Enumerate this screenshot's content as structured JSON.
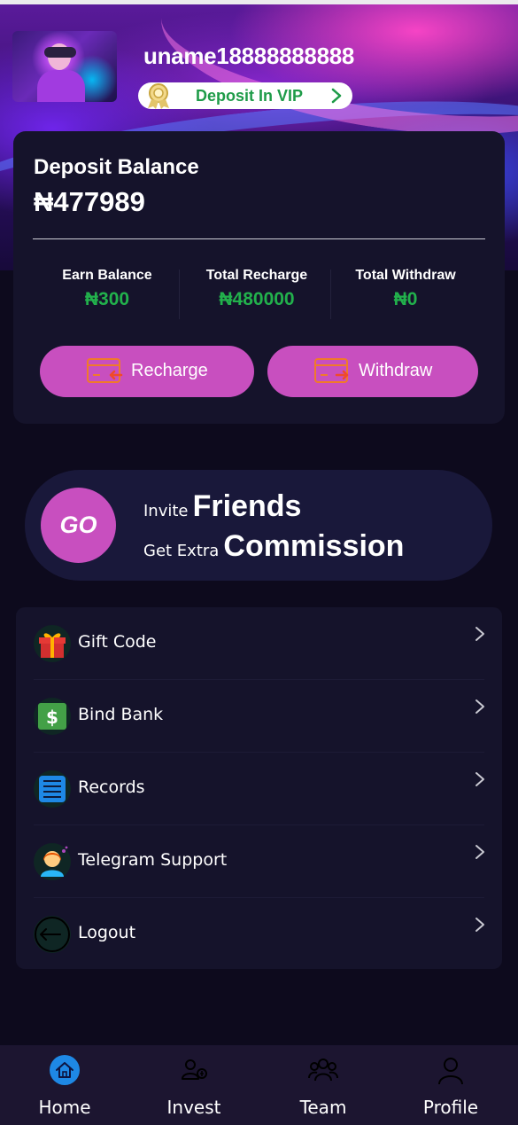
{
  "header": {
    "username": "uname18888888888",
    "vip_label": "Deposit In VIP"
  },
  "balance": {
    "label": "Deposit Balance",
    "value": "₦477989",
    "stats": [
      {
        "label": "Earn Balance",
        "value": "₦300"
      },
      {
        "label": "Total Recharge",
        "value": "₦480000"
      },
      {
        "label": "Total Withdraw",
        "value": "₦0"
      }
    ],
    "recharge_label": "Recharge",
    "withdraw_label": "Withdraw"
  },
  "invite": {
    "go_label": "GO",
    "line1_small": "Invite",
    "line1_big": "Friends",
    "line2_small": "Get Extra",
    "line2_big": "Commission"
  },
  "menu": {
    "items": [
      {
        "label": "Gift Code",
        "icon": "gift-icon"
      },
      {
        "label": "Bind Bank",
        "icon": "dollar-icon"
      },
      {
        "label": "Records",
        "icon": "list-icon"
      },
      {
        "label": "Telegram Support",
        "icon": "support-agent-icon"
      },
      {
        "label": "Logout",
        "icon": "logout-icon"
      }
    ]
  },
  "tabbar": {
    "tabs": [
      {
        "label": "Home",
        "icon": "home-icon",
        "active": true
      },
      {
        "label": "Invest",
        "icon": "invest-icon",
        "active": false
      },
      {
        "label": "Team",
        "icon": "team-icon",
        "active": false
      },
      {
        "label": "Profile",
        "icon": "profile-icon",
        "active": false
      }
    ]
  },
  "colors": {
    "accent_pink": "#c84fbf",
    "positive_green": "#22b14c",
    "card_bg": "#15132b",
    "page_bg": "#0d0a1d",
    "active_tab_blue": "#1e88e5"
  }
}
